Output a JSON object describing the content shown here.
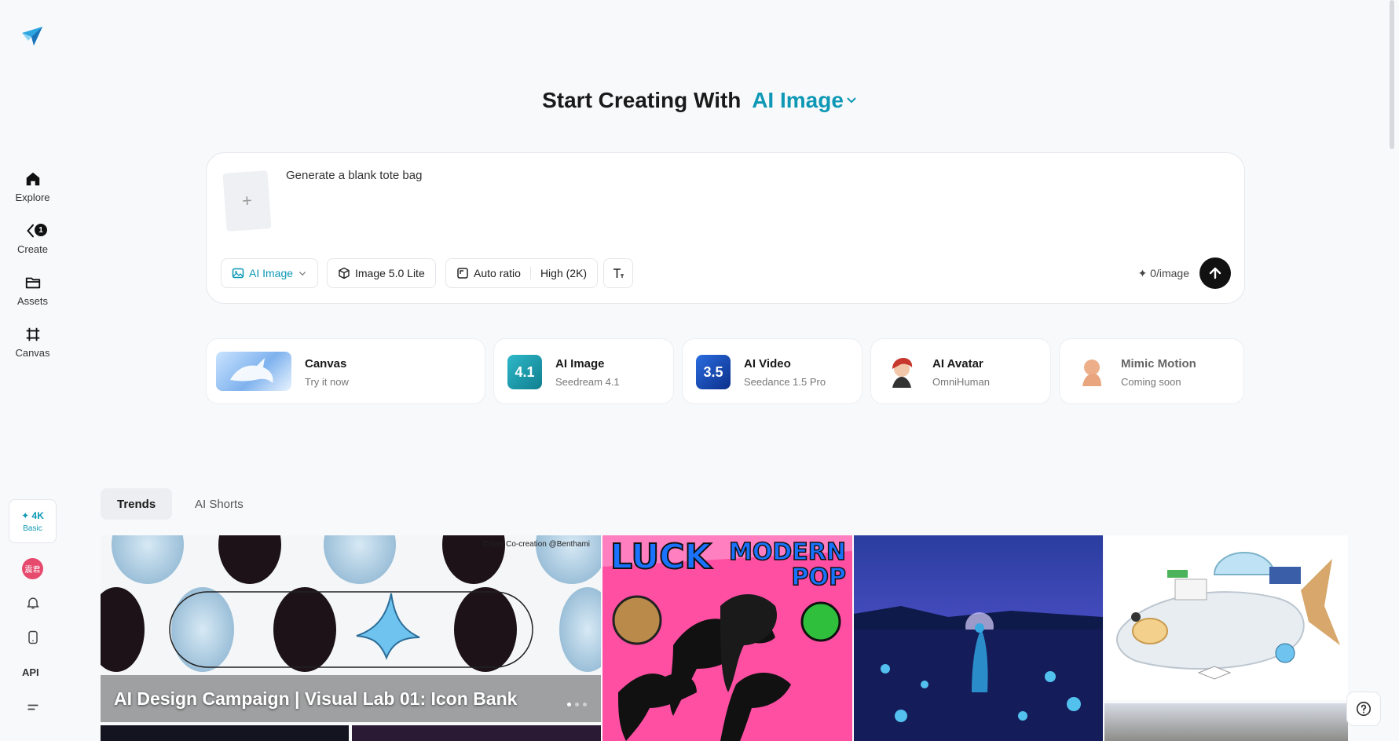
{
  "sidebar": {
    "items": [
      {
        "label": "Explore",
        "icon": "home-icon"
      },
      {
        "label": "Create",
        "icon": "create-icon",
        "badge": "1"
      },
      {
        "label": "Assets",
        "icon": "folder-icon"
      },
      {
        "label": "Canvas",
        "icon": "canvas-icon"
      }
    ],
    "credits": {
      "amount": "✦ 4K",
      "plan": "Basic"
    },
    "avatar_text": "震君",
    "api_label": "API"
  },
  "heading": {
    "prefix": "Start Creating With",
    "mode": "AI Image"
  },
  "prompt": {
    "text": "Generate a blank tote bag",
    "upload_icon": "+",
    "chips": {
      "mode": "AI Image",
      "model": "Image 5.0 Lite",
      "ratio": "Auto ratio",
      "quality": "High (2K)"
    },
    "cost": "✦ 0/image"
  },
  "features": [
    {
      "title": "Canvas",
      "sub": "Try it now"
    },
    {
      "title": "AI Image",
      "sub": "Seedream 4.1",
      "thumb_text": "4.1"
    },
    {
      "title": "AI Video",
      "sub": "Seedance 1.5 Pro",
      "thumb_text": "3.5"
    },
    {
      "title": "AI Avatar",
      "sub": "OmniHuman"
    },
    {
      "title": "Mimic Motion",
      "sub": "Coming soon"
    }
  ],
  "tabs": [
    {
      "label": "Trends",
      "active": true
    },
    {
      "label": "AI Shorts",
      "active": false
    }
  ],
  "gallery": {
    "featured_title": "AI Design Campaign | Visual Lab 01: Icon Bank",
    "featured_credit": "Cover Co-creation @Benthami",
    "luck_text": "LUCK",
    "modern_pop_text": "MODERN POP"
  },
  "colors": {
    "accent": "#0d98b5",
    "send": "#111111"
  }
}
